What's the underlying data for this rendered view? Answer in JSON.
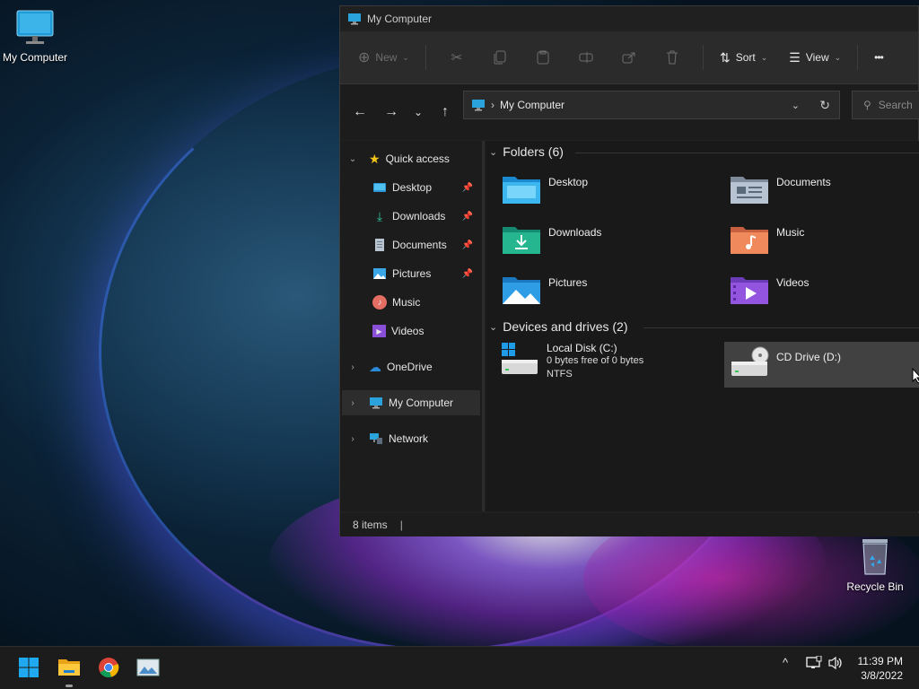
{
  "desktop": {
    "my_computer_label": "My Computer",
    "recycle_bin_label": "Recycle Bin"
  },
  "window": {
    "title": "My Computer",
    "toolbar": {
      "new_label": "New",
      "sort_label": "Sort",
      "view_label": "View",
      "more_label": "•••"
    },
    "address": {
      "path": "My Computer",
      "search_placeholder": "Search"
    },
    "nav": {
      "quick_access": "Quick access",
      "items": [
        "Desktop",
        "Downloads",
        "Documents",
        "Pictures",
        "Music",
        "Videos"
      ],
      "onedrive": "OneDrive",
      "my_computer": "My Computer",
      "network": "Network"
    },
    "folders_header": "Folders (6)",
    "folders": [
      "Desktop",
      "Documents",
      "Downloads",
      "Music",
      "Pictures",
      "Videos"
    ],
    "devices_header": "Devices and drives (2)",
    "drives": [
      {
        "name": "Local Disk (C:)",
        "free": "0 bytes free of 0 bytes",
        "fs": "NTFS"
      },
      {
        "name": "CD Drive (D:)"
      }
    ],
    "status": "8 items"
  },
  "taskbar": {
    "time": "11:39 PM",
    "date": "3/8/2022"
  },
  "colors": {
    "accent": "#0078d4",
    "window_bg": "#202020",
    "selected": "#414141"
  }
}
